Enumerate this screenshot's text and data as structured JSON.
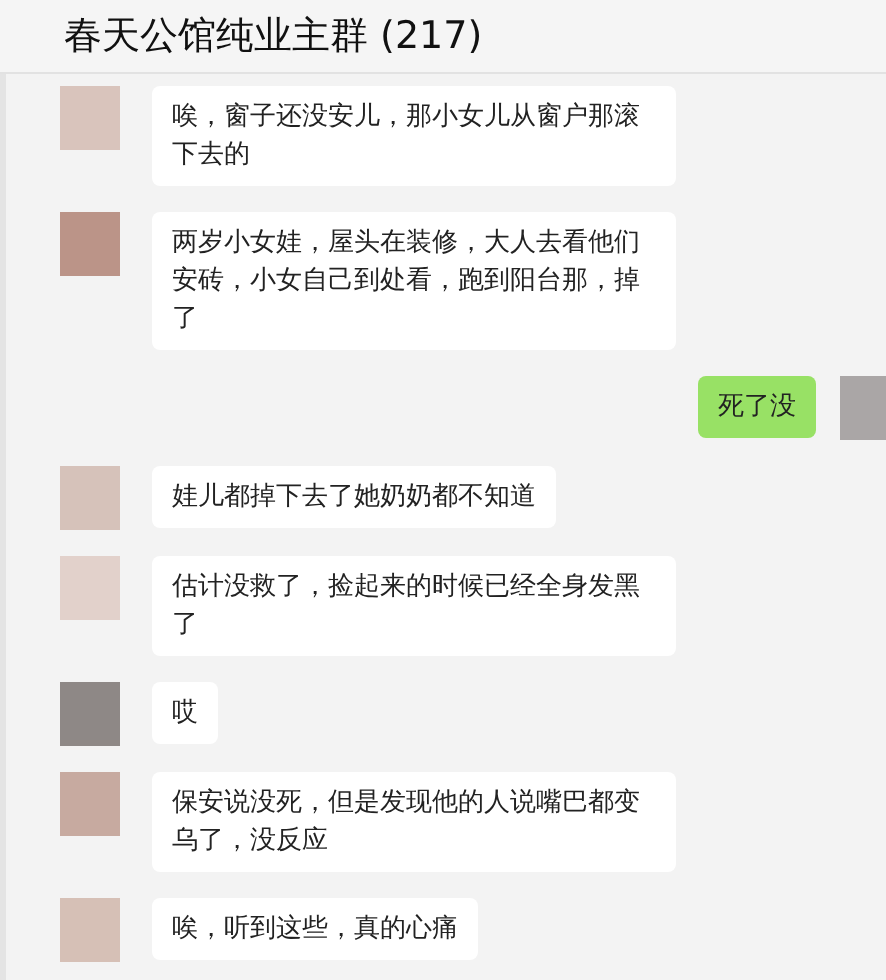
{
  "window": {
    "title": "春天公馆纯业主群 (217)"
  },
  "messages": [
    {
      "kind": "received",
      "text": "唉，窗子还没安儿，那小女儿从窗户那滚下去的",
      "color": "#d9c4bc"
    },
    {
      "kind": "received",
      "text": "两岁小女娃，屋头在装修，大人去看他们安砖，小女自己到处看，跑到阳台那，掉了",
      "color": "#bb9488"
    },
    {
      "kind": "sent",
      "text": "死了没",
      "color": "#aaa6a6"
    },
    {
      "kind": "received",
      "text": "娃儿都掉下去了她奶奶都不知道",
      "color": "#d6c2ba"
    },
    {
      "kind": "received",
      "text": "估计没救了，捡起来的时候已经全身发黑了",
      "color": "#e2d1cb"
    },
    {
      "kind": "received",
      "text": "哎",
      "color": "#8e8886"
    },
    {
      "kind": "received",
      "text": "保安说没死，但是发现他的人说嘴巴都变乌了，没反应",
      "color": "#c7aaa0"
    },
    {
      "kind": "received",
      "text": "唉，听到这些，真的心痛",
      "color": "#d6c0b6"
    }
  ]
}
